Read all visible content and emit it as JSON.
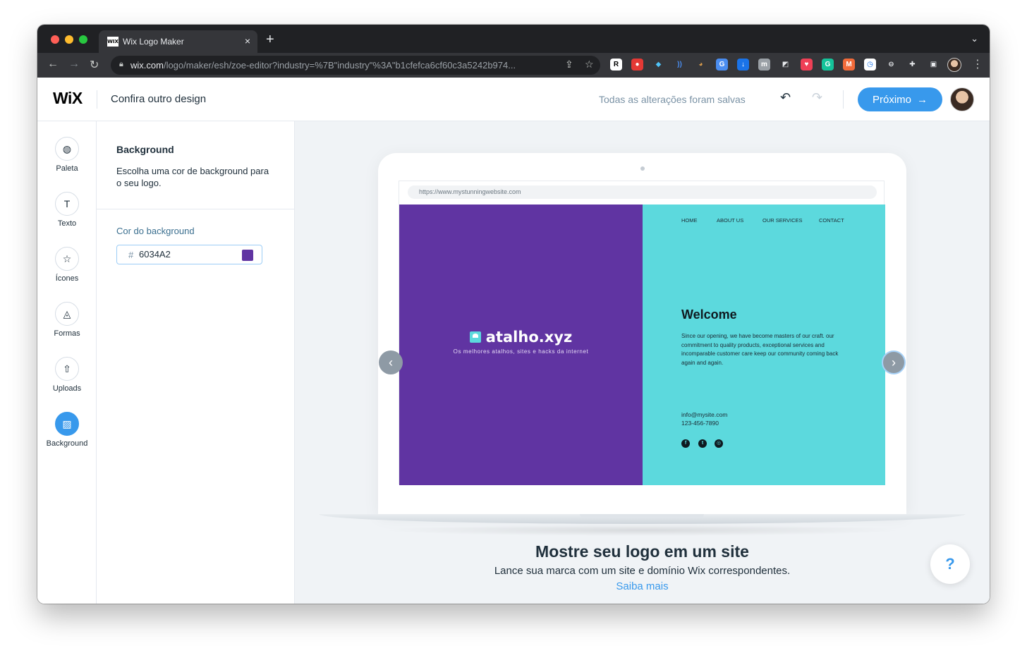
{
  "browser": {
    "tab_title": "Wix Logo Maker",
    "tab_favicon": "WIX",
    "tab_close": "×",
    "new_tab": "+",
    "url_host": "wix.com",
    "url_path": "/logo/maker/esh/zoe-editor?industry=%7B\"industry\"%3A\"b1cfefca6cf60c3a5242b974...",
    "extensions": [
      {
        "name": "r-icon",
        "glyph": "R",
        "color": "#ffffff",
        "text": "#000000"
      },
      {
        "name": "pokeball-icon",
        "glyph": "●",
        "color": "#e53935",
        "text": "#ffffff"
      },
      {
        "name": "diamond-icon",
        "glyph": "◆",
        "color": "#35363a",
        "text": "#4fc3f7"
      },
      {
        "name": "wave-icon",
        "glyph": "))",
        "color": "#35363a",
        "text": "#4a8df0"
      },
      {
        "name": "monkey-icon",
        "glyph": "◕",
        "color": "#35363a",
        "text": "#d69a4c"
      },
      {
        "name": "translate-icon",
        "glyph": "G",
        "color": "#4a8df0",
        "text": "#ffffff"
      },
      {
        "name": "download-icon",
        "glyph": "↓",
        "color": "#1a73e8",
        "text": "#ffffff"
      },
      {
        "name": "m-icon",
        "glyph": "m",
        "color": "#9aa0a6",
        "text": "#ffffff"
      },
      {
        "name": "compass-icon",
        "glyph": "◩",
        "color": "#35363a",
        "text": "#e8eaed"
      },
      {
        "name": "pocket-icon",
        "glyph": "♥",
        "color": "#ef4056",
        "text": "#ffffff"
      },
      {
        "name": "grammarly-icon",
        "glyph": "G",
        "color": "#15c39a",
        "text": "#ffffff"
      },
      {
        "name": "mm-icon",
        "glyph": "M",
        "color": "#f26b3a",
        "text": "#ffffff"
      },
      {
        "name": "clock-icon",
        "glyph": "◷",
        "color": "#ffffff",
        "text": "#1a73e8"
      },
      {
        "name": "block-icon",
        "glyph": "⊖",
        "color": "#35363a",
        "text": "#e8eaed"
      },
      {
        "name": "puzzle-icon",
        "glyph": "✚",
        "color": "#35363a",
        "text": "#e8eaed"
      },
      {
        "name": "sidepanel-icon",
        "glyph": "▣",
        "color": "#35363a",
        "text": "#e8eaed"
      }
    ]
  },
  "header": {
    "logo": "WiX",
    "title": "Confira outro design",
    "saved_status": "Todas as alterações foram salvas",
    "next_label": "Próximo"
  },
  "sidebar": {
    "items": [
      {
        "label": "Paleta",
        "icon": "palette-icon",
        "glyph": "◍",
        "active": false
      },
      {
        "label": "Texto",
        "icon": "text-icon",
        "glyph": "T",
        "active": false
      },
      {
        "label": "Ícones",
        "icon": "star-icon",
        "glyph": "☆",
        "active": false
      },
      {
        "label": "Formas",
        "icon": "shapes-icon",
        "glyph": "◬",
        "active": false
      },
      {
        "label": "Uploads",
        "icon": "upload-icon",
        "glyph": "⇧",
        "active": false
      },
      {
        "label": "Background",
        "icon": "background-icon",
        "glyph": "▨",
        "active": true
      }
    ]
  },
  "panel": {
    "title": "Background",
    "description": "Escolha uma cor de background para o seu logo.",
    "color_label": "Cor do background",
    "hash": "#",
    "color_value": "6034A2",
    "swatch_color": "#6034A2"
  },
  "preview": {
    "site_url": "https://www.mystunningwebsite.com",
    "logo_name": "atalho.xyz",
    "logo_tagline": "Os melhores atalhos, sites e hacks da internet",
    "nav": [
      "HOME",
      "ABOUT US",
      "OUR SERVICES",
      "CONTACT"
    ],
    "welcome_title": "Welcome",
    "welcome_body": "Since our opening, we have become masters of our craft. our commitment to quality products, exceptional services and incomparable customer care keep our community coming back again and again.",
    "email": "info@mysite.com",
    "phone": "123-456-7890",
    "left_color": "#6034A2",
    "right_color": "#5CD9DD",
    "cta_title": "Mostre seu logo em um site",
    "cta_subtitle": "Lance sua marca com um site e domínio Wix correspondentes.",
    "cta_link": "Saiba mais",
    "help_label": "?"
  }
}
